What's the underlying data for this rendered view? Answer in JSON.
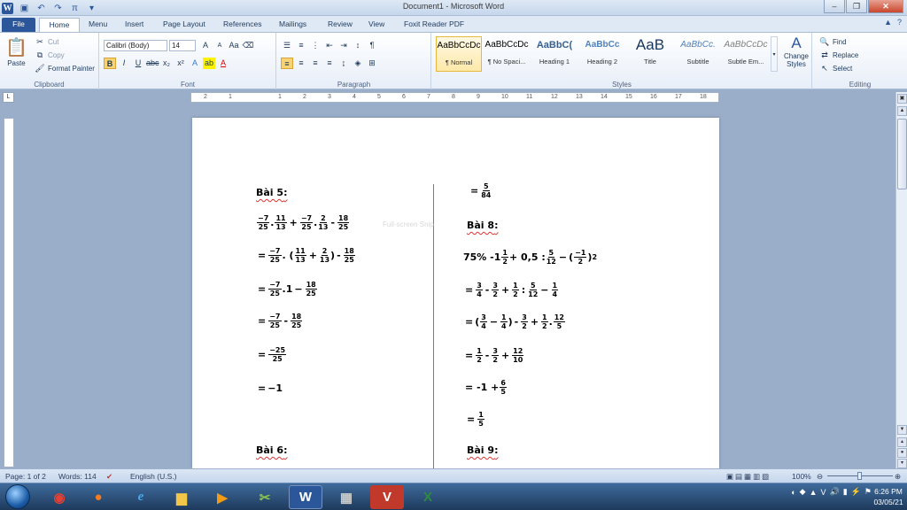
{
  "window": {
    "title": "Document1 - Microsoft Word"
  },
  "tabs": [
    "File",
    "Home",
    "Menu",
    "Insert",
    "Page Layout",
    "References",
    "Mailings",
    "Review",
    "View",
    "Foxit Reader PDF"
  ],
  "ribbon": {
    "clipboard": {
      "paste": "Paste",
      "cut": "Cut",
      "copy": "Copy",
      "format_painter": "Format Painter",
      "label": "Clipboard"
    },
    "font": {
      "name": "Calibri (Body)",
      "size": "14",
      "label": "Font"
    },
    "paragraph": {
      "label": "Paragraph"
    },
    "styles": {
      "label": "Styles",
      "items": [
        {
          "sample": "AaBbCcDc",
          "name": "¶ Normal"
        },
        {
          "sample": "AaBbCcDc",
          "name": "¶ No Spaci..."
        },
        {
          "sample": "AaBbC(",
          "name": "Heading 1"
        },
        {
          "sample": "AaBbCc",
          "name": "Heading 2"
        },
        {
          "sample": "AaB",
          "name": "Title"
        },
        {
          "sample": "AaBbCc.",
          "name": "Subtitle"
        },
        {
          "sample": "AaBbCcDc",
          "name": "Subtle Em..."
        }
      ],
      "change_styles": "Change Styles"
    },
    "editing": {
      "find": "Find",
      "replace": "Replace",
      "select": "Select",
      "label": "Editing"
    }
  },
  "ruler": {
    "numbers": [
      "2",
      "1",
      "1",
      "2",
      "3",
      "4",
      "5",
      "6",
      "7",
      "8",
      "9",
      "10",
      "11",
      "12",
      "13",
      "14",
      "15",
      "16",
      "17",
      "18"
    ]
  },
  "document": {
    "ghost_text": "Full-screen Snip",
    "left": {
      "heading5": "Bài 5",
      "heading6": "Bài 6",
      "l1": {
        "f1n": "−7",
        "f1d": "25",
        "f2n": "11",
        "f2d": "13",
        "f3n": "−7",
        "f3d": "25",
        "f4n": "2",
        "f4d": "13",
        "f5n": "18",
        "f5d": "25"
      },
      "l2": {
        "f1n": "−7",
        "f1d": "25",
        "f2n": "11",
        "f2d": "13",
        "f3n": "2",
        "f3d": "13",
        "f4n": "18",
        "f4d": "25"
      },
      "l3": {
        "f1n": "−7",
        "f1d": "25",
        "one": "1",
        "f2n": "18",
        "f2d": "25"
      },
      "l4": {
        "f1n": "−7",
        "f1d": "25",
        "f2n": "18",
        "f2d": "25"
      },
      "l5": {
        "f1n": "−25",
        "f1d": "25"
      },
      "l6": {
        "val": "−1"
      }
    },
    "right": {
      "top": {
        "fn": "5",
        "fd": "84"
      },
      "heading8": "Bài 8",
      "heading9": "Bài 9",
      "r1": {
        "a": "75% -1",
        "f1n": "1",
        "f1d": "2",
        "b": "+ 0,5 :",
        "f2n": "5",
        "f2d": "12",
        "f3n": "−1",
        "f3d": "2",
        "exp": "2"
      },
      "r2": {
        "f1n": "3",
        "f1d": "4",
        "f2n": "3",
        "f2d": "2",
        "f3n": "1",
        "f3d": "2",
        "f4n": "5",
        "f4d": "12",
        "f5n": "1",
        "f5d": "4"
      },
      "r3": {
        "f1n": "3",
        "f1d": "4",
        "f2n": "1",
        "f2d": "4",
        "f3n": "3",
        "f3d": "2",
        "f4n": "1",
        "f4d": "2",
        "f5n": "12",
        "f5d": "5"
      },
      "r4": {
        "f1n": "1",
        "f1d": "2",
        "f2n": "3",
        "f2d": "2",
        "f3n": "12",
        "f3d": "10"
      },
      "r5": {
        "a": "= -1 +",
        "fn": "6",
        "fd": "5"
      },
      "r6": {
        "fn": "1",
        "fd": "5"
      }
    }
  },
  "status": {
    "page": "Page: 1 of 2",
    "words": "Words: 114",
    "language": "English (U.S.)",
    "zoom": "100%"
  },
  "clock": {
    "time": "6:26 PM",
    "date": "03/05/21"
  }
}
